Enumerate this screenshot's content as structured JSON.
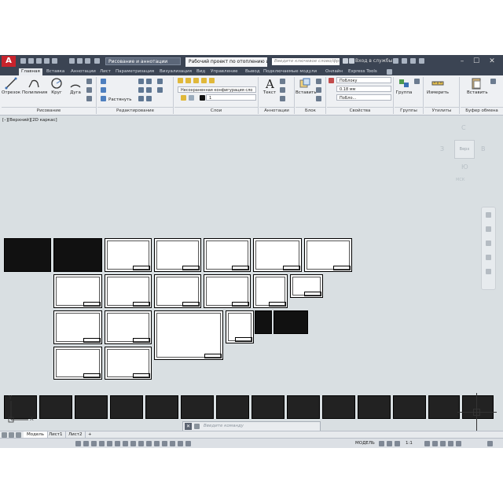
{
  "app": {
    "logo": "A"
  },
  "titlebar": {
    "workspace": "Рисование и аннотации",
    "document_tab": "Рабочий проект по отоплению и ве...",
    "search_placeholder": "Введите ключевое слово/фразу",
    "signin": "Вход в службы"
  },
  "menu": [
    "Главная",
    "Вставка",
    "Аннотации",
    "Лист",
    "Параметризация",
    "Визуализация",
    "Вид",
    "Управление",
    "Вывод",
    "Подключаемые модули",
    "Онлайн",
    "Express Tools"
  ],
  "ribbon": {
    "tools": {
      "line": "Отрезок",
      "polyline": "Полилиния",
      "circle": "Круг",
      "arc": "Дуга",
      "stretch": "Растянуть",
      "text": "Текст",
      "insert": "Вставить",
      "group": "Группа",
      "measure": "Измерить",
      "paste": "Вставить"
    },
    "layer_combo": "Несохраненная конфигурация сло",
    "layer_current": "1",
    "prop_color": "ПоБлоку",
    "prop_lineweight": "0.18 мм",
    "prop_linetype": "ПоБло...",
    "panels": {
      "draw": "Рисование",
      "modify": "Редактирование",
      "layers": "Слои",
      "annotation": "Аннотации",
      "block": "Блок",
      "properties": "Свойства",
      "groups": "Группы",
      "utilities": "Утилиты",
      "clipboard": "Буфер обмена"
    }
  },
  "viewport": {
    "label": "[–][Верхний][2D каркас]",
    "viewcube": {
      "north": "С",
      "west": "З",
      "east": "В",
      "south": "Ю",
      "face": "Верх",
      "ucs": "МСК"
    }
  },
  "command": {
    "placeholder": "Введите команду"
  },
  "layout_tabs": [
    "Модель",
    "Лист1",
    "Лист2"
  ],
  "status": {
    "mode": "МОДЕЛЬ",
    "scale": "1:1"
  },
  "ucs": {
    "x": "X",
    "y": "Y"
  }
}
